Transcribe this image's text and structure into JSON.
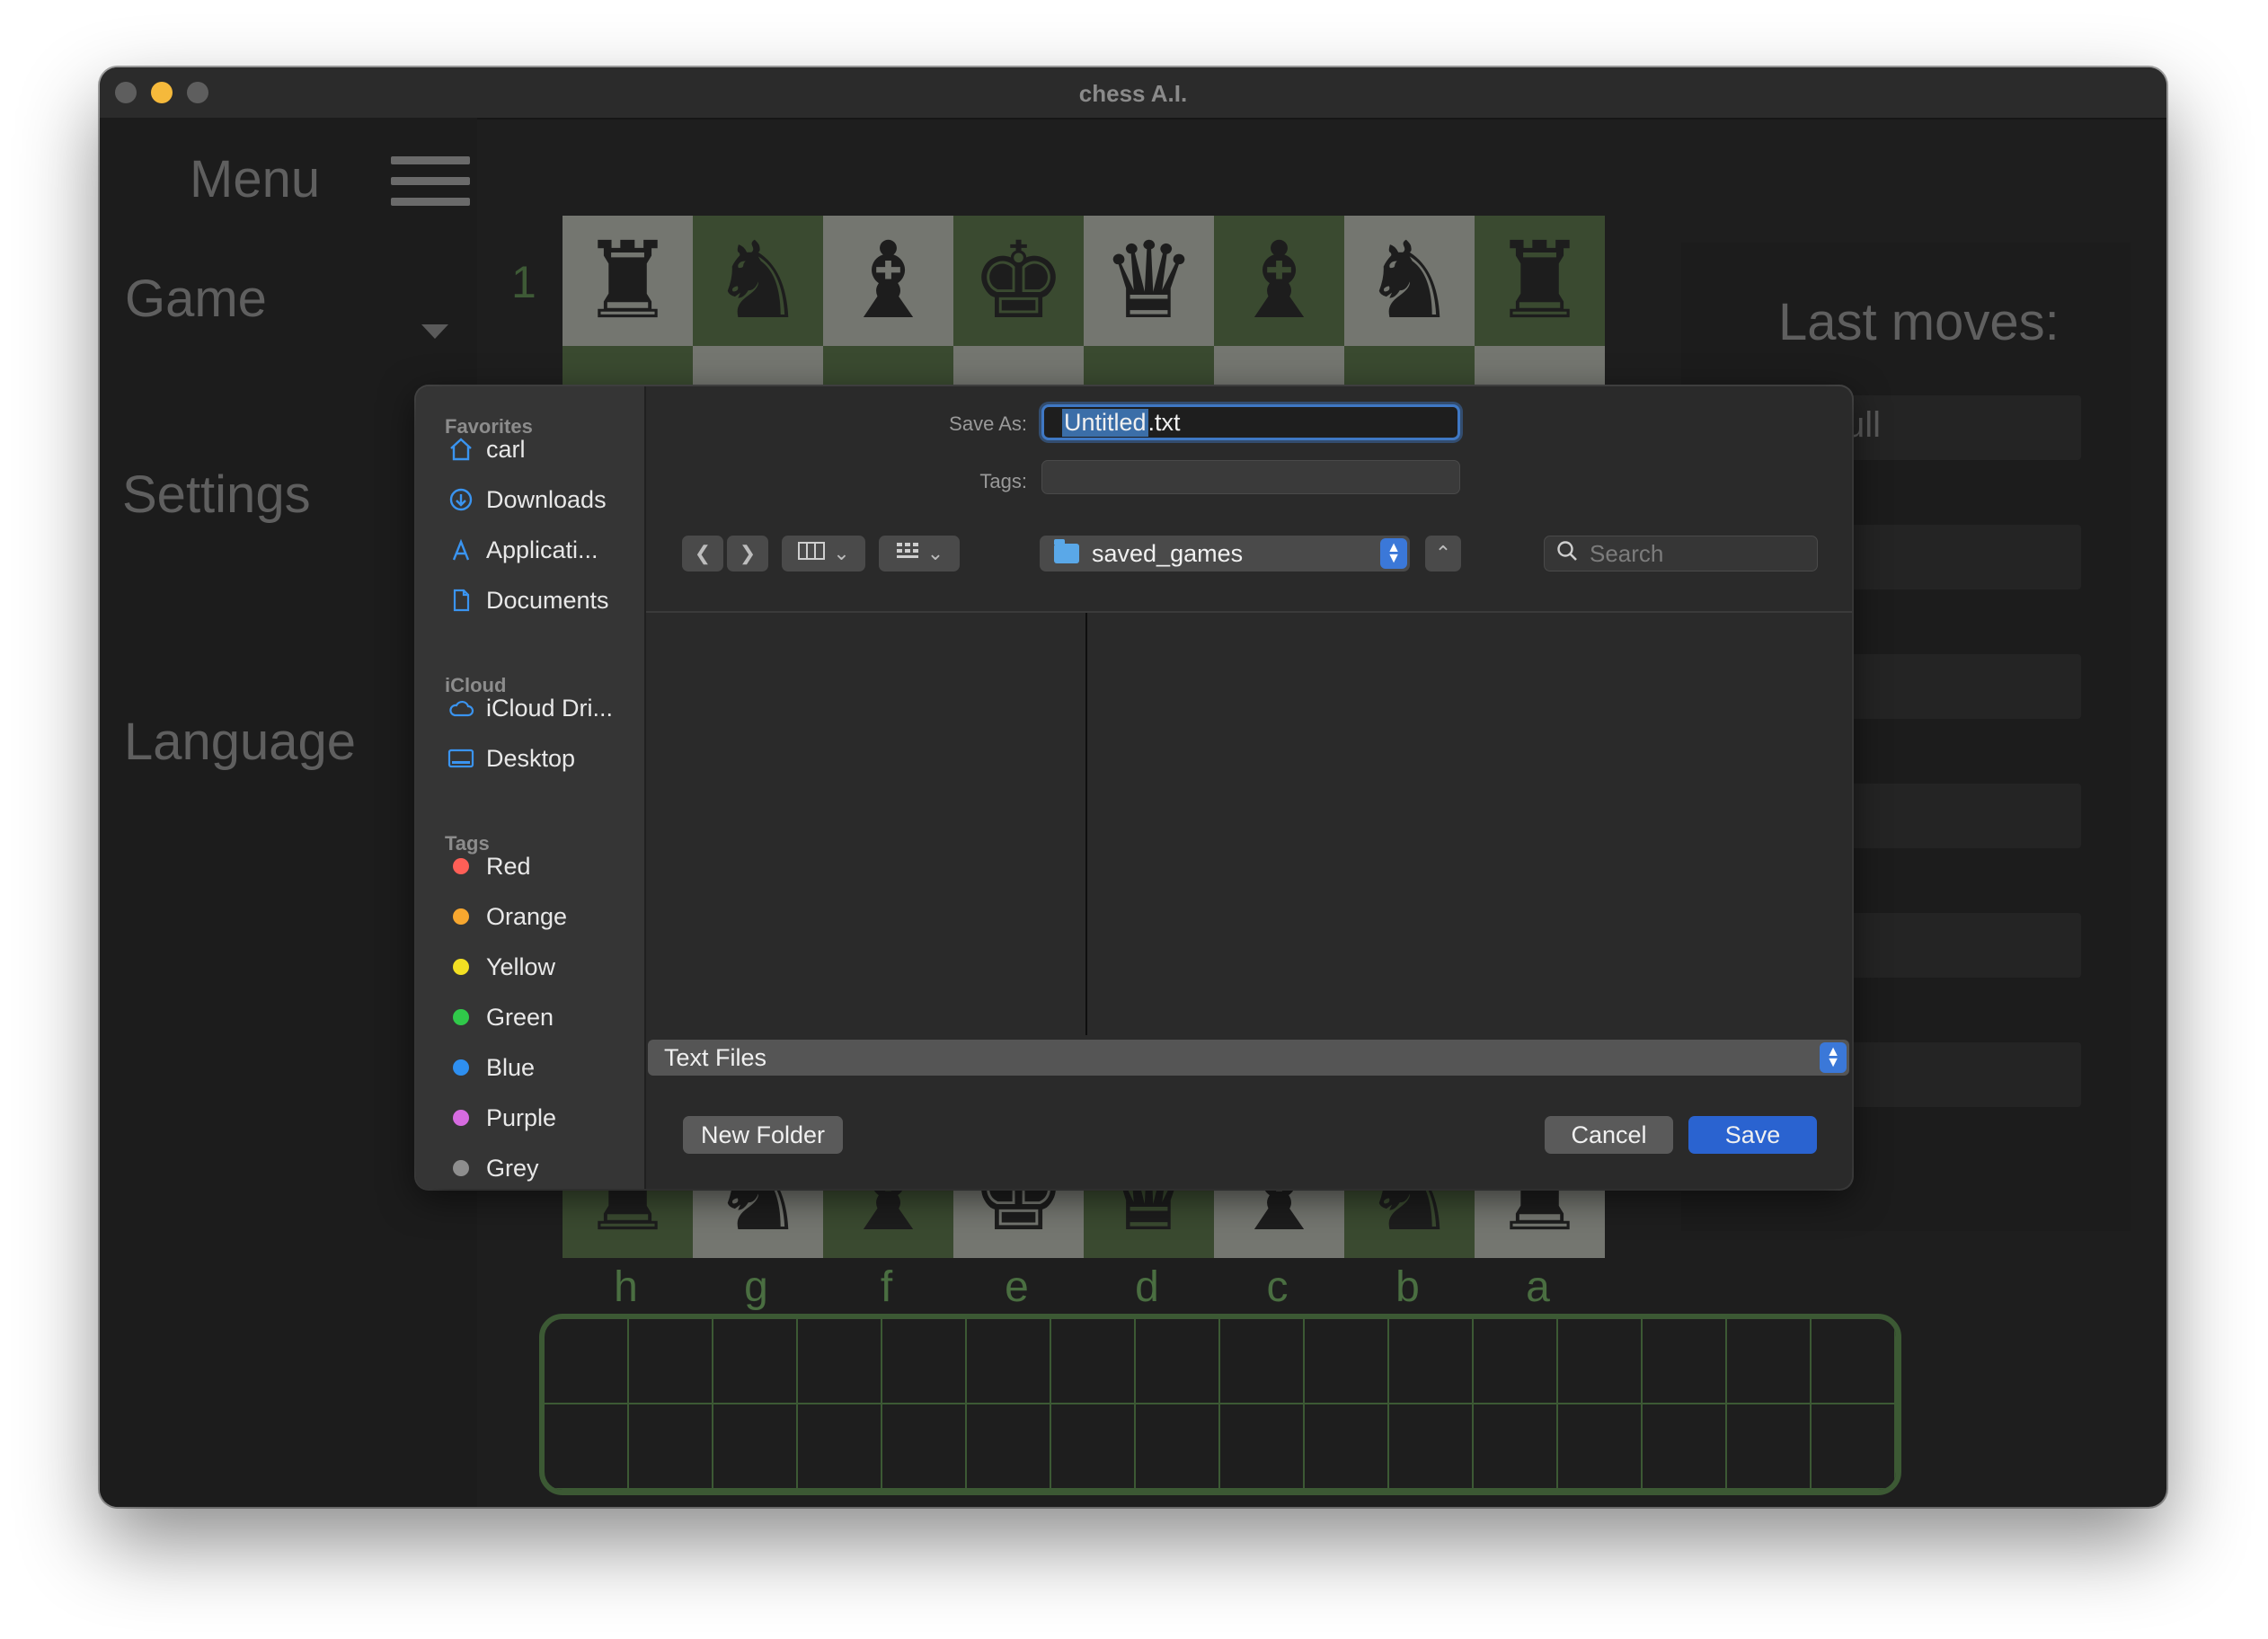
{
  "window": {
    "title": "chess A.I."
  },
  "sidebar_menu": {
    "title": "Menu",
    "items": [
      {
        "label": "Game"
      },
      {
        "label": "Settings"
      },
      {
        "label": "Language"
      }
    ]
  },
  "board": {
    "rank_label": "1",
    "file_labels": [
      "h",
      "g",
      "f",
      "e",
      "d",
      "c",
      "b",
      "a"
    ],
    "top_row": [
      "♜",
      "♞",
      "♝",
      "♚",
      "♛",
      "♝",
      "♞",
      "♜"
    ],
    "bottom_row": [
      "♜",
      "♞",
      "♝",
      "♚",
      "♛",
      "♝",
      "♞",
      "♜"
    ]
  },
  "last_moves": {
    "title": "Last moves:",
    "first_row_text": "ull"
  },
  "save_dialog": {
    "save_as_label": "Save As:",
    "filename_selected": "Untitled",
    "filename_ext": ".txt",
    "tags_label": "Tags:",
    "location": "saved_games",
    "search_placeholder": "Search",
    "file_type": "Text Files",
    "new_folder_label": "New Folder",
    "cancel_label": "Cancel",
    "save_label": "Save",
    "sidebar": {
      "favorites_header": "Favorites",
      "favorites": [
        {
          "label": "carl",
          "icon": "home-icon"
        },
        {
          "label": "Downloads",
          "icon": "download-icon"
        },
        {
          "label": "Applicati...",
          "icon": "applications-icon"
        },
        {
          "label": "Documents",
          "icon": "document-icon"
        }
      ],
      "icloud_header": "iCloud",
      "icloud": [
        {
          "label": "iCloud Dri...",
          "icon": "cloud-icon"
        },
        {
          "label": "Desktop",
          "icon": "desktop-icon"
        }
      ],
      "tags_header": "Tags",
      "tags": [
        {
          "label": "Red",
          "color": "#ff5f57"
        },
        {
          "label": "Orange",
          "color": "#f7a72f"
        },
        {
          "label": "Yellow",
          "color": "#f3e023"
        },
        {
          "label": "Green",
          "color": "#30c94a"
        },
        {
          "label": "Blue",
          "color": "#2e8ff0"
        },
        {
          "label": "Purple",
          "color": "#d66be0"
        },
        {
          "label": "Grey",
          "color": "#8e8e8e"
        }
      ]
    }
  }
}
